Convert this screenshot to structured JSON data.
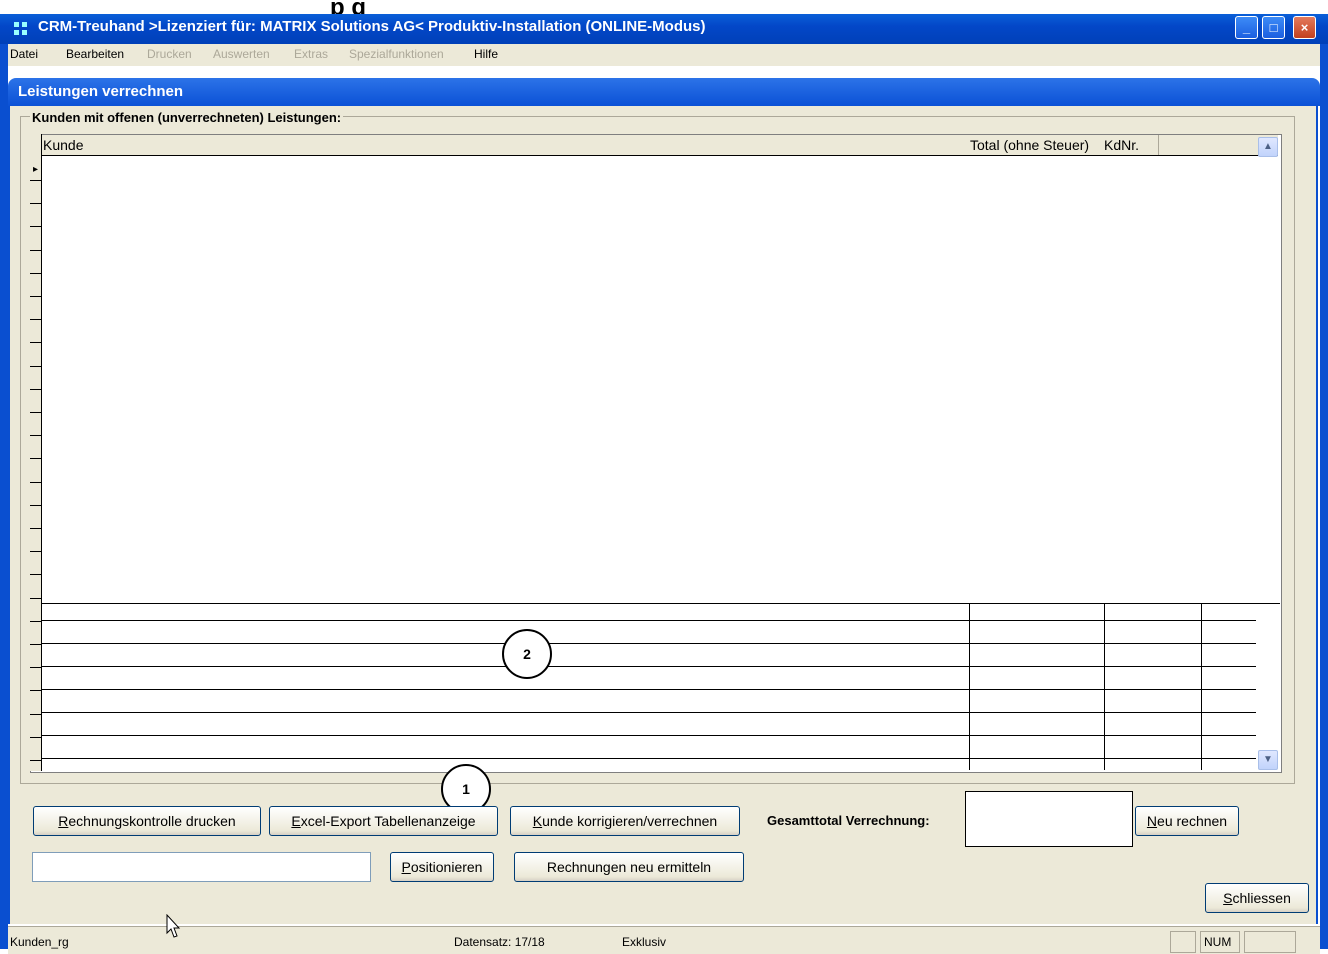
{
  "window": {
    "title": "CRM-Treuhand >Lizenziert für: MATRIX Solutions AG< Produktiv-Installation (ONLINE-Modus)",
    "top_cut_text": "p                                 g",
    "controls": [
      "_",
      "□",
      "×"
    ]
  },
  "menu": {
    "items": [
      {
        "label": "Datei",
        "enabled": true
      },
      {
        "label": "Bearbeiten",
        "enabled": true
      },
      {
        "label": "Drucken",
        "enabled": false
      },
      {
        "label": "Auswerten",
        "enabled": false
      },
      {
        "label": "Extras",
        "enabled": false
      },
      {
        "label": "Spezialfunktionen",
        "enabled": false
      },
      {
        "label": "Hilfe",
        "enabled": true
      }
    ]
  },
  "form": {
    "title": "Leistungen verrechnen",
    "group_label": "Kunden mit offenen (unverrechneten) Leistungen:"
  },
  "grid": {
    "columns": [
      "Kunde",
      "Total (ohne Steuer)",
      "KdNr."
    ],
    "row_indicator": "▸",
    "rows": []
  },
  "callouts": {
    "one": "1",
    "two": "2"
  },
  "buttons": {
    "rechnungskontrolle": "Rechnungskontrolle drucken",
    "excel_export": "Excel-Export Tabellenanzeige",
    "kunde_korrigieren": "Kunde korrigieren/verrechnen",
    "neu_rechnen": "Neu rechnen",
    "positionieren": "Positionieren",
    "rechnungen_neu": "Rechnungen neu ermitteln",
    "schliessen": "Schliessen"
  },
  "gesamttotal": {
    "label": "Gesamttotal Verrechnung:",
    "value": ""
  },
  "search": {
    "value": ""
  },
  "statusbar": {
    "table": "Kunden_rg",
    "record": "Datensatz: 17/18",
    "mode": "Exklusiv",
    "num": "NUM"
  },
  "colors": {
    "title_blue": "#0347c8",
    "face": "#ece9d8"
  }
}
